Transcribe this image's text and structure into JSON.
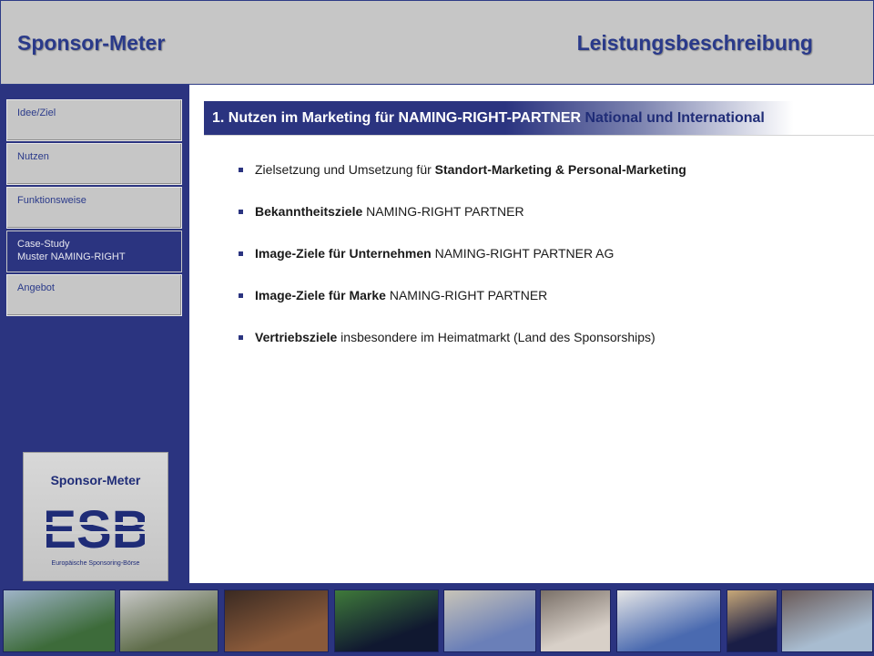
{
  "header": {
    "app_title": "Sponsor-Meter",
    "doc_title": "Leistungsbeschreibung"
  },
  "sidebar": {
    "items": [
      {
        "label": "Idee/Ziel",
        "label2": "",
        "active": false
      },
      {
        "label": "Nutzen",
        "label2": "",
        "active": false
      },
      {
        "label": "Funktionsweise",
        "label2": "",
        "active": false
      },
      {
        "label": "Case-Study",
        "label2": "Muster NAMING-RIGHT",
        "active": true
      },
      {
        "label": "Angebot",
        "label2": "",
        "active": false
      }
    ]
  },
  "logo": {
    "title": "Sponsor-Meter",
    "mark": "ESB",
    "subtitle": "Europäische Sponsoring-Börse"
  },
  "section": {
    "heading": "1. Nutzen im Marketing für NAMING-RIGHT-PARTNER ",
    "heading_tail": "National und International"
  },
  "bullets": [
    {
      "pre": "Zielsetzung und Umsetzung für ",
      "bold": "Standort-Marketing & Personal-Marketing",
      "post": ""
    },
    {
      "pre": "",
      "bold": "Bekanntheitsziele",
      "post": " NAMING-RIGHT PARTNER"
    },
    {
      "pre": "",
      "bold": "Image-Ziele für Unternehmen",
      "post": " NAMING-RIGHT PARTNER AG"
    },
    {
      "pre": "",
      "bold": "Image-Ziele für Marke",
      "post": " NAMING-RIGHT PARTNER"
    },
    {
      "pre": "",
      "bold": "Vertriebsziele",
      "post": " insbesondere im Heimatmarkt (Land des Sponsorships)"
    }
  ],
  "photos": [
    {
      "name": "stadium-photo",
      "colors": [
        "#3d6b3a",
        "#9fb4c8"
      ]
    },
    {
      "name": "racing-car-photo",
      "colors": [
        "#5f6d4a",
        "#c8c8c8"
      ]
    },
    {
      "name": "crowd-photo",
      "colors": [
        "#8a5a3a",
        "#3a2a22"
      ]
    },
    {
      "name": "night-stadium-photo",
      "colors": [
        "#101830",
        "#3f7a3a"
      ]
    },
    {
      "name": "building-photo",
      "colors": [
        "#6a7fb8",
        "#c8c4b8"
      ]
    },
    {
      "name": "face-photo",
      "colors": [
        "#d8d0c8",
        "#7a7068"
      ]
    },
    {
      "name": "banner-photo",
      "colors": [
        "#4a6ab0",
        "#e6e6e6"
      ]
    },
    {
      "name": "ferris-wheel-photo",
      "colors": [
        "#1a1e46",
        "#c8a878"
      ]
    },
    {
      "name": "festival-photo",
      "colors": [
        "#a8bcd0",
        "#6a5a58"
      ]
    }
  ]
}
